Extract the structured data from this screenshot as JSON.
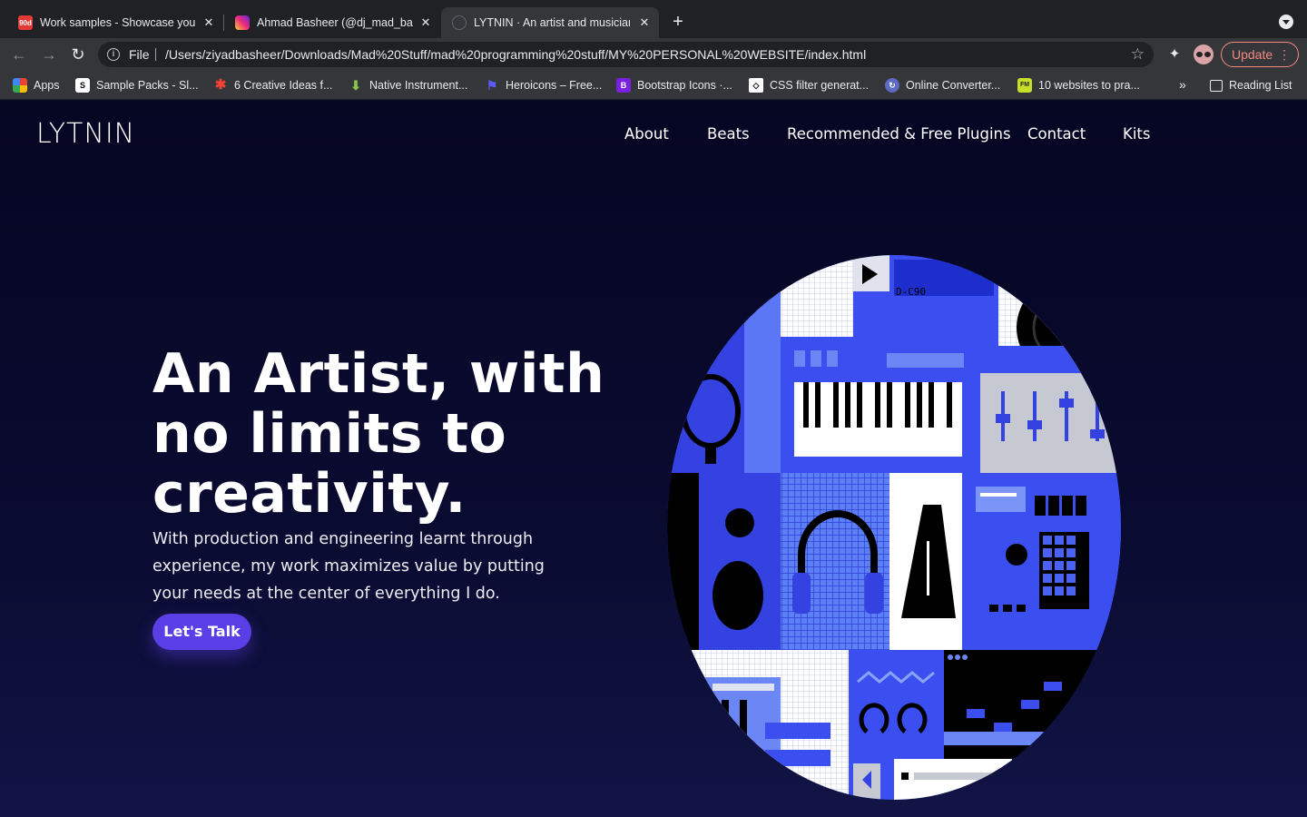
{
  "browser": {
    "tabs": [
      {
        "title": "Work samples - Showcase your",
        "favicon_text": "90d",
        "favicon_color": "#e53935"
      },
      {
        "title": "Ahmad Basheer (@dj_mad_bas",
        "favicon_text": "",
        "favicon_color": "#d62976"
      },
      {
        "title": "LYTNIN · An artist and musician",
        "favicon_text": "",
        "favicon_color": "#35363a"
      }
    ],
    "new_tab_icon": "+",
    "address": {
      "scheme_label": "File",
      "url": "/Users/ziyadbasheer/Downloads/Mad%20Stuff/mad%20programming%20stuff/MY%20PERSONAL%20WEBSITE/index.html"
    },
    "update_label": "Update",
    "bookmarks": [
      {
        "label": "Apps",
        "icon": "apps-grid-icon"
      },
      {
        "label": "Sample Packs - Sl...",
        "icon": "splice-icon"
      },
      {
        "label": "6 Creative Ideas f...",
        "icon": "asterisk-icon"
      },
      {
        "label": "Native Instrument...",
        "icon": "download-arrow-icon"
      },
      {
        "label": "Heroicons – Free...",
        "icon": "flag-icon"
      },
      {
        "label": "Bootstrap Icons ·...",
        "icon": "bootstrap-icon"
      },
      {
        "label": "CSS filter generat...",
        "icon": "codepen-icon"
      },
      {
        "label": "Online Converter...",
        "icon": "converter-icon"
      },
      {
        "label": "10 websites to pra...",
        "icon": "frontend-icon"
      }
    ],
    "more_bookmarks": "»",
    "reading_list": "Reading List"
  },
  "site": {
    "logo": "LYTNIN",
    "nav": [
      "About",
      "Beats",
      "Recommended & Free Plugins",
      "Contact",
      "Kits"
    ],
    "hero": {
      "title": "An Artist, with no limits to creativity.",
      "subtitle": "With production and engineering learnt through experience, my work maximizes value by putting your needs at the center of everything I do.",
      "cta": "Let's Talk"
    },
    "artwork_text": "D-C90",
    "colors": {
      "accent": "#5b3fe6",
      "background": "#0a0b2e",
      "art_blue": "#3b4ff0"
    }
  }
}
